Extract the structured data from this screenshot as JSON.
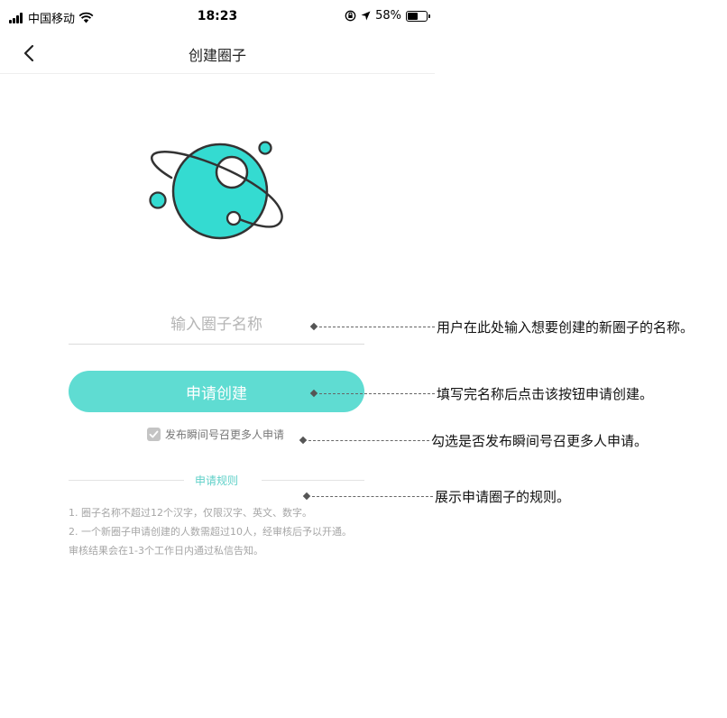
{
  "status_bar": {
    "carrier": "中国移动",
    "time": "18:23",
    "battery": "58%",
    "battery_level": 0.58,
    "icons": [
      "signal-icon",
      "wifi-icon",
      "orientation-lock-icon",
      "location-icon",
      "battery-icon"
    ]
  },
  "nav": {
    "title": "创建圈子",
    "back_icon": "chevron-left-icon"
  },
  "illustration": {
    "icon": "planet-illustration",
    "accent_color": "#34dbd1"
  },
  "form": {
    "name_placeholder": "输入圈子名称",
    "name_value": "",
    "apply_label": "申请创建",
    "publish_checkbox_label": "发布瞬间号召更多人申请",
    "publish_checked": true
  },
  "rules": {
    "title": "申请规则",
    "lines": [
      "1. 圈子名称不超过12个汉字，仅限汉字、英文、数字。",
      "2. 一个新圈子申请创建的人数需超过10人，经审核后予以开通。审核结果会在1-3个工作日内通过私信告知。"
    ]
  },
  "annotations": [
    "用户在此处输入想要创建的新圈子的名称。",
    "填写完名称后点击该按钮申请创建。",
    "勾选是否发布瞬间号召更多人申请。",
    "展示申请圈子的规则。"
  ],
  "colors": {
    "accent": "#5fdcd2",
    "rules_title": "#5fd0c8",
    "text_muted": "#a6a6a6"
  }
}
